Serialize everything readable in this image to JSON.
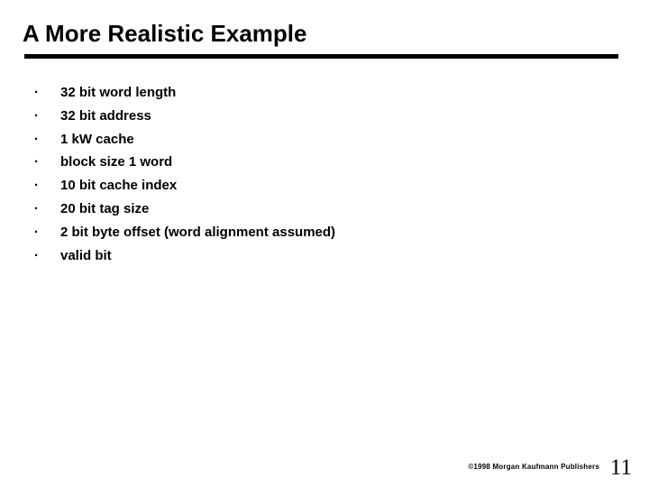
{
  "slide": {
    "title": "A More Realistic Example",
    "bullet_marker": "·",
    "bullets": [
      {
        "text": "32 bit word length"
      },
      {
        "text": "32 bit address"
      },
      {
        "text": "1 kW cache"
      },
      {
        "text": "block size 1 word"
      },
      {
        "text": "10 bit cache index"
      },
      {
        "text": "20 bit tag size"
      },
      {
        "text": "2 bit byte offset (word alignment assumed)"
      },
      {
        "text": "valid bit"
      }
    ],
    "footer": {
      "copyright": "©1998 Morgan Kaufmann Publishers",
      "slide_number": "11"
    },
    "colors": {
      "background": "#ffffff",
      "text": "#000000",
      "rule": "#000000"
    }
  }
}
